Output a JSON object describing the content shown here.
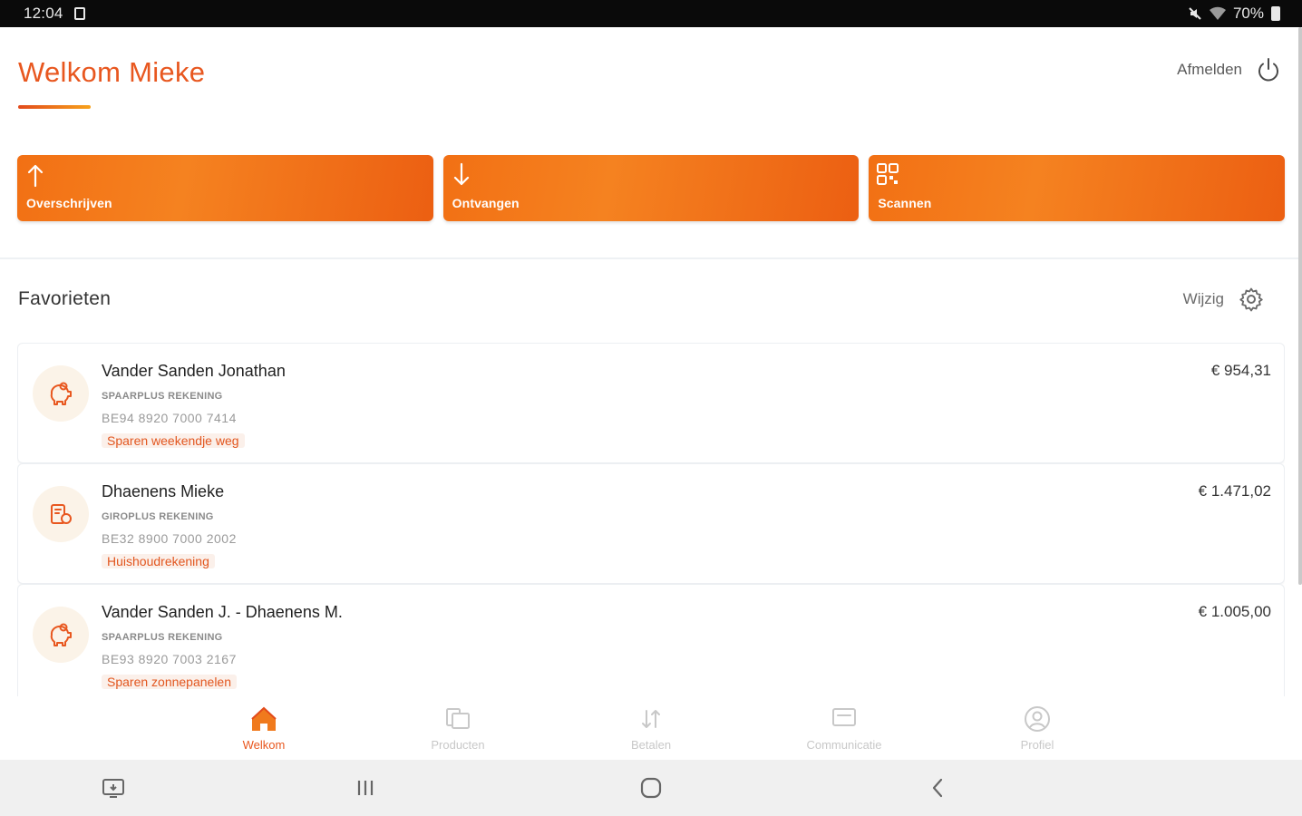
{
  "status_bar": {
    "time": "12:04",
    "battery": "70%"
  },
  "header": {
    "title": "Welkom Mieke",
    "logout_label": "Afmelden"
  },
  "actions": [
    {
      "label": "Overschrijven",
      "icon": "arrow-up-icon"
    },
    {
      "label": "Ontvangen",
      "icon": "arrow-down-icon"
    },
    {
      "label": "Scannen",
      "icon": "qr-code-icon"
    }
  ],
  "favorites": {
    "title": "Favorieten",
    "edit_label": "Wijzig",
    "items": [
      {
        "name": "Vander Sanden Jonathan",
        "type": "SPAARPLUS REKENING",
        "iban": "BE94 8920 7000 7414",
        "tag": "Sparen weekendje weg",
        "amount": "€ 954,31",
        "icon": "piggy-bank-icon"
      },
      {
        "name": "Dhaenens Mieke",
        "type": "GIROPLUS REKENING",
        "iban": "BE32 8900 7000 2002",
        "tag": "Huishoudrekening",
        "amount": "€ 1.471,02",
        "icon": "wallet-icon"
      },
      {
        "name": "Vander Sanden J. - Dhaenens M.",
        "type": "SPAARPLUS REKENING",
        "iban": "BE93 8920 7003 2167",
        "tag": "Sparen zonnepanelen",
        "amount": "€ 1.005,00",
        "icon": "piggy-bank-icon"
      }
    ]
  },
  "tabs": [
    {
      "label": "Welkom",
      "icon": "home-icon",
      "active": true
    },
    {
      "label": "Producten",
      "icon": "products-icon",
      "active": false
    },
    {
      "label": "Betalen",
      "icon": "transfer-arrows-icon",
      "active": false
    },
    {
      "label": "Communicatie",
      "icon": "message-icon",
      "active": false
    },
    {
      "label": "Profiel",
      "icon": "profile-icon",
      "active": false
    }
  ],
  "colors": {
    "brand": "#e8571f",
    "accent_gradient_start": "#f27014",
    "accent_gradient_end": "#ec5f12"
  }
}
